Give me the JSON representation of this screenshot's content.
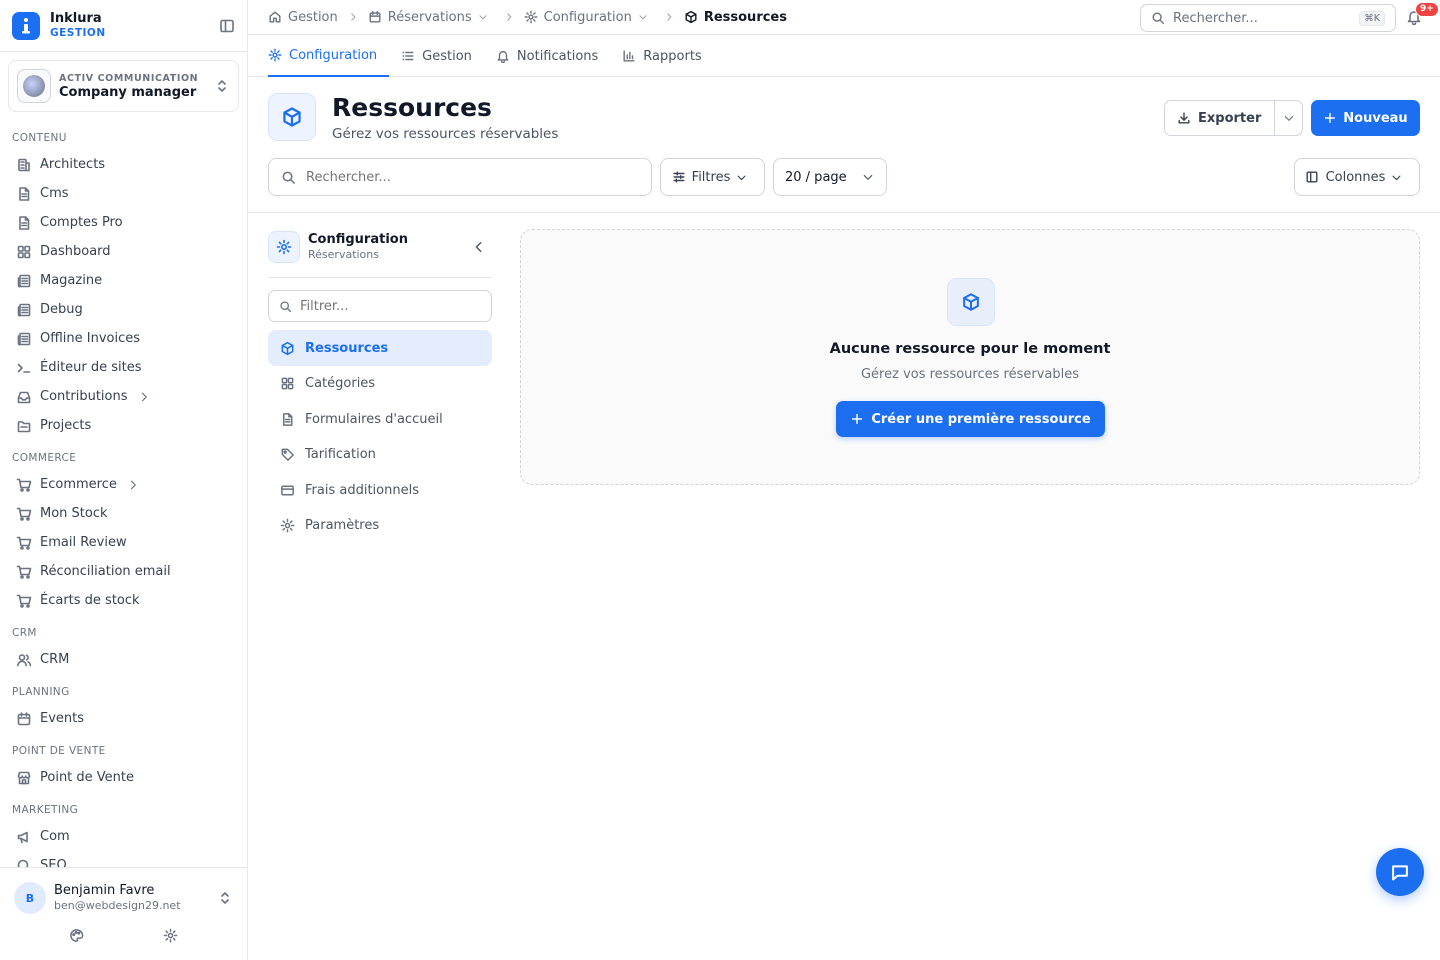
{
  "brand": {
    "name": "Inklura",
    "subtitle": "GESTION"
  },
  "org": {
    "kicker": "ACTIV COMMUNICATION",
    "name": "Company manager"
  },
  "sidebar": {
    "sections": [
      {
        "title": "CONTENU",
        "items": [
          {
            "label": "Architects",
            "icon": "building-icon"
          },
          {
            "label": "Cms",
            "icon": "document-icon"
          },
          {
            "label": "Comptes Pro",
            "icon": "document-icon"
          },
          {
            "label": "Dashboard",
            "icon": "grid-icon"
          },
          {
            "label": "Magazine",
            "icon": "newspaper-icon"
          },
          {
            "label": "Debug",
            "icon": "newspaper-icon"
          },
          {
            "label": "Offline Invoices",
            "icon": "newspaper-icon"
          },
          {
            "label": "Éditeur de sites",
            "icon": "terminal-icon"
          },
          {
            "label": "Contributions",
            "icon": "inbox-icon",
            "has_children": true
          },
          {
            "label": "Projects",
            "icon": "folder-icon"
          }
        ]
      },
      {
        "title": "COMMERCE",
        "items": [
          {
            "label": "Ecommerce",
            "icon": "cart-icon",
            "has_children": true
          },
          {
            "label": "Mon Stock",
            "icon": "cart-icon"
          },
          {
            "label": "Email Review",
            "icon": "cart-icon"
          },
          {
            "label": "Réconciliation email",
            "icon": "cart-icon"
          },
          {
            "label": "Écarts de stock",
            "icon": "cart-icon"
          }
        ]
      },
      {
        "title": "CRM",
        "items": [
          {
            "label": "CRM",
            "icon": "users-icon"
          }
        ]
      },
      {
        "title": "PLANNING",
        "items": [
          {
            "label": "Events",
            "icon": "calendar-icon"
          }
        ]
      },
      {
        "title": "POINT DE VENTE",
        "items": [
          {
            "label": "Point de Vente",
            "icon": "store-icon"
          }
        ]
      },
      {
        "title": "MARKETING",
        "items": [
          {
            "label": "Com",
            "icon": "megaphone-icon"
          },
          {
            "label": "SEO",
            "icon": "search-icon"
          }
        ]
      }
    ]
  },
  "user": {
    "initial": "B",
    "name": "Benjamin Favre",
    "email": "ben@webdesign29.net"
  },
  "breadcrumb": {
    "home": "Gestion",
    "level1": "Réservations",
    "level2": "Configuration",
    "current": "Ressources"
  },
  "top_search": {
    "placeholder": "Rechercher...",
    "shortcut": "⌘K"
  },
  "notifications": {
    "badge": "9+"
  },
  "tabs": [
    {
      "label": "Configuration",
      "icon": "gear-icon",
      "active": true
    },
    {
      "label": "Gestion",
      "icon": "list-icon",
      "active": false
    },
    {
      "label": "Notifications",
      "icon": "bell-icon",
      "active": false
    },
    {
      "label": "Rapports",
      "icon": "bar-chart-icon",
      "active": false
    }
  ],
  "page": {
    "title": "Ressources",
    "subtitle": "Gérez vos ressources réservables"
  },
  "actions": {
    "export": "Exporter",
    "new": "Nouveau"
  },
  "toolbar": {
    "search_placeholder": "Rechercher...",
    "filters": "Filtres",
    "per_page": "20 / page",
    "columns": "Colonnes"
  },
  "config_panel": {
    "title": "Configuration",
    "subtitle": "Réservations",
    "filter_placeholder": "Filtrer...",
    "items": [
      {
        "label": "Ressources",
        "icon": "box-icon",
        "active": true
      },
      {
        "label": "Catégories",
        "icon": "grid-icon",
        "active": false
      },
      {
        "label": "Formulaires d'accueil",
        "icon": "document-icon",
        "active": false
      },
      {
        "label": "Tarification",
        "icon": "tag-icon",
        "active": false
      },
      {
        "label": "Frais additionnels",
        "icon": "credit-card-icon",
        "active": false
      },
      {
        "label": "Paramètres",
        "icon": "gear-icon",
        "active": false
      }
    ]
  },
  "empty_state": {
    "title": "Aucune ressource pour le moment",
    "subtitle": "Gérez vos ressources réservables",
    "cta": "Créer une première ressource"
  },
  "colors": {
    "accent": "#1d6ff2",
    "badge": "#ef4444",
    "active_bg": "#e3edfd"
  }
}
